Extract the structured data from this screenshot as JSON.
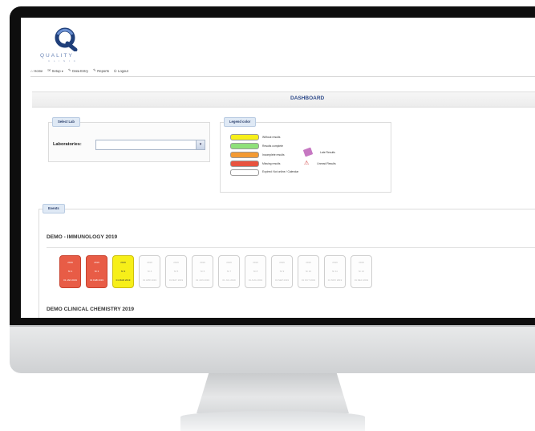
{
  "app": {
    "logo_text": "QUALITY",
    "logo_sub": "C L I N I C"
  },
  "nav": [
    {
      "icon": "home-icon",
      "glyph": "⌂",
      "label": "Home"
    },
    {
      "icon": "setup-icon",
      "glyph": "✉",
      "label": "Setup ▾"
    },
    {
      "icon": "pencil-icon",
      "glyph": "✎",
      "label": "Data Entry"
    },
    {
      "icon": "pencil-icon",
      "glyph": "✎",
      "label": "Reports"
    },
    {
      "icon": "logout-icon",
      "glyph": "⏻",
      "label": "Logout"
    }
  ],
  "dashboard": {
    "title": "DASHBOARD"
  },
  "select_lab": {
    "tab_label": "Select Lab",
    "field_label": "Laboratories:",
    "value": "",
    "button_glyph": "▾"
  },
  "legend": {
    "tab_label": "Legend color",
    "items": [
      {
        "label": "Without results",
        "color": "#f7ef19"
      },
      {
        "label": "Results complete",
        "color": "#8fe07a"
      },
      {
        "label": "Incomplete results",
        "color": "#f39a33"
      },
      {
        "label": "Missing results",
        "color": "#e8533f"
      },
      {
        "label": "Expired: Not online / Calendar",
        "color": "#ffffff"
      }
    ],
    "late_label": "Late Results",
    "unread_label": "Unread Results"
  },
  "events": {
    "tab_label": "Events",
    "sections": [
      {
        "title": "DEMO - IMMUNOLOGY 2019",
        "tiles": [
          {
            "status": "red",
            "line1": "2019",
            "line2": "Nr 1",
            "line3": "01 JAN 2019"
          },
          {
            "status": "red",
            "line1": "2019",
            "line2": "Nr 2",
            "line3": "01 FEB 2019"
          },
          {
            "status": "yellow",
            "line1": "2019",
            "line2": "Nr 3",
            "line3": "01 MAR 2019"
          },
          {
            "status": "empty",
            "line1": "2019",
            "line2": "Nr 4",
            "line3": "01 APR 2019"
          },
          {
            "status": "empty",
            "line1": "2019",
            "line2": "Nr 5",
            "line3": "01 MAY 2019"
          },
          {
            "status": "empty",
            "line1": "2019",
            "line2": "Nr 6",
            "line3": "01 JUN 2019"
          },
          {
            "status": "empty",
            "line1": "2019",
            "line2": "Nr 7",
            "line3": "01 JUL 2019"
          },
          {
            "status": "empty",
            "line1": "2019",
            "line2": "Nr 8",
            "line3": "01 AUG 2019"
          },
          {
            "status": "empty",
            "line1": "2019",
            "line2": "Nr 9",
            "line3": "01 SEP 2019"
          },
          {
            "status": "empty",
            "line1": "2019",
            "line2": "Nr 10",
            "line3": "01 OCT 2019"
          },
          {
            "status": "empty",
            "line1": "2019",
            "line2": "Nr 11",
            "line3": "01 NOV 2019"
          },
          {
            "status": "empty",
            "line1": "2019",
            "line2": "Nr 12",
            "line3": "01 DEC 2019"
          }
        ]
      },
      {
        "title": "DEMO CLINICAL CHEMISTRY 2019"
      }
    ]
  }
}
